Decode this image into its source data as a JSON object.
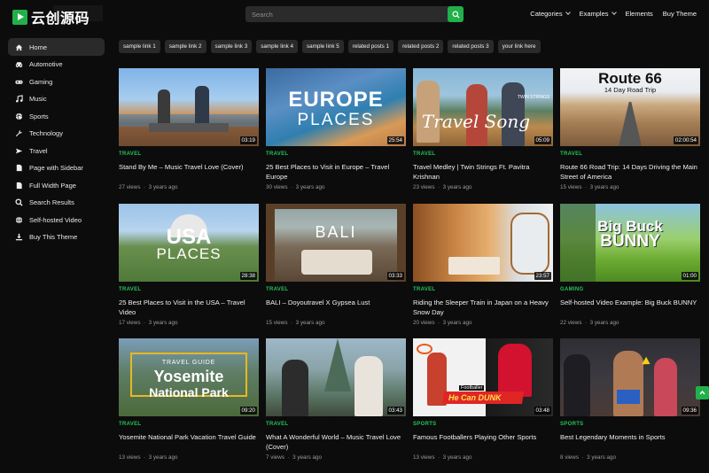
{
  "brand": {
    "name": "云创源码"
  },
  "search": {
    "placeholder": "Search"
  },
  "nav": [
    {
      "label": "Categories",
      "dropdown": true
    },
    {
      "label": "Examples",
      "dropdown": true
    },
    {
      "label": "Elements",
      "dropdown": false
    },
    {
      "label": "Buy Theme",
      "dropdown": false
    }
  ],
  "sidebar": {
    "items": [
      {
        "label": "Home",
        "icon": "home-icon",
        "active": true
      },
      {
        "label": "Automotive",
        "icon": "car-icon"
      },
      {
        "label": "Gaming",
        "icon": "gamepad-icon"
      },
      {
        "label": "Music",
        "icon": "music-icon"
      },
      {
        "label": "Sports",
        "icon": "sports-icon"
      },
      {
        "label": "Technology",
        "icon": "wrench-icon"
      },
      {
        "label": "Travel",
        "icon": "plane-icon"
      },
      {
        "label": "Page with Sidebar",
        "icon": "page-icon"
      },
      {
        "label": "Full Width Page",
        "icon": "page-icon"
      },
      {
        "label": "Search Results",
        "icon": "search-icon"
      },
      {
        "label": "Self-hosted Video",
        "icon": "globe-icon"
      },
      {
        "label": "Buy This Theme",
        "icon": "download-icon"
      }
    ]
  },
  "tags": [
    "sample link 1",
    "sample link 2",
    "sample link 3",
    "sample link 4",
    "sample link 5",
    "related posts 1",
    "related posts 2",
    "related posts 3",
    "your link here"
  ],
  "videos": [
    {
      "category": "TRAVEL",
      "title": "Stand By Me – Music Travel Love (Cover)",
      "views": "27 views",
      "age": "3 years ago",
      "duration": "03:19",
      "thumb_text": ""
    },
    {
      "category": "TRAVEL",
      "title": "25 Best Places to Visit in Europe – Travel Europe",
      "views": "30 views",
      "age": "3 years ago",
      "duration": "25:54",
      "thumb_text": "EUROPE",
      "thumb_sub": "PLACES"
    },
    {
      "category": "TRAVEL",
      "title": "Travel Medley | Twin Strings Ft. Pavitra Krishnan",
      "views": "23 views",
      "age": "3 years ago",
      "duration": "05:09",
      "thumb_text": "Travel Song",
      "thumb_sub": "TWIN STRINGS"
    },
    {
      "category": "TRAVEL",
      "title": "Route 66 Road Trip: 14 Days Driving the Main Street of America",
      "views": "15 views",
      "age": "3 years ago",
      "duration": "02:00:54",
      "thumb_text": "Route 66",
      "thumb_sub": "14 Day Road Trip"
    },
    {
      "category": "TRAVEL",
      "title": "25 Best Places to Visit in the USA – Travel Video",
      "views": "17 views",
      "age": "3 years ago",
      "duration": "28:38",
      "thumb_text": "USA",
      "thumb_sub": "PLACES"
    },
    {
      "category": "TRAVEL",
      "title": "BALI – Doyoutravel X Gypsea Lust",
      "views": "15 views",
      "age": "3 years ago",
      "duration": "03:33",
      "thumb_text": "BALI",
      "thumb_sub": ""
    },
    {
      "category": "TRAVEL",
      "title": "Riding the Sleeper Train in Japan on a Heavy Snow Day",
      "views": "20 views",
      "age": "3 years ago",
      "duration": "23:57",
      "thumb_text": "",
      "thumb_sub": ""
    },
    {
      "category": "GAMING",
      "title": "Self-hosted Video Example: Big Buck BUNNY",
      "views": "22 views",
      "age": "3 years ago",
      "duration": "01:00",
      "thumb_text": "Big Buck",
      "thumb_sub": "BUNNY"
    },
    {
      "category": "TRAVEL",
      "title": "Yosemite National Park Vacation Travel Guide",
      "views": "13 views",
      "age": "3 years ago",
      "duration": "09:20",
      "thumb_text": "Yosemite",
      "thumb_sub": "National Park",
      "thumb_top": "TRAVEL GUIDE"
    },
    {
      "category": "TRAVEL",
      "title": "What A Wonderful World – Music Travel Love (Cover)",
      "views": "7 views",
      "age": "3 years ago",
      "duration": "03:43",
      "thumb_text": "",
      "thumb_sub": ""
    },
    {
      "category": "SPORTS",
      "title": "Famous Footballers Playing Other Sports",
      "views": "13 views",
      "age": "3 years ago",
      "duration": "03:48",
      "thumb_text": "He Can DUNK",
      "thumb_sub": "Footballer"
    },
    {
      "category": "SPORTS",
      "title": "Best Legendary Moments in Sports",
      "views": "8 views",
      "age": "3 years ago",
      "duration": "09:36",
      "thumb_text": "",
      "thumb_sub": ""
    }
  ],
  "colors": {
    "accent": "#22b04b",
    "category": "#22c35a",
    "background": "#0c0c0c"
  }
}
